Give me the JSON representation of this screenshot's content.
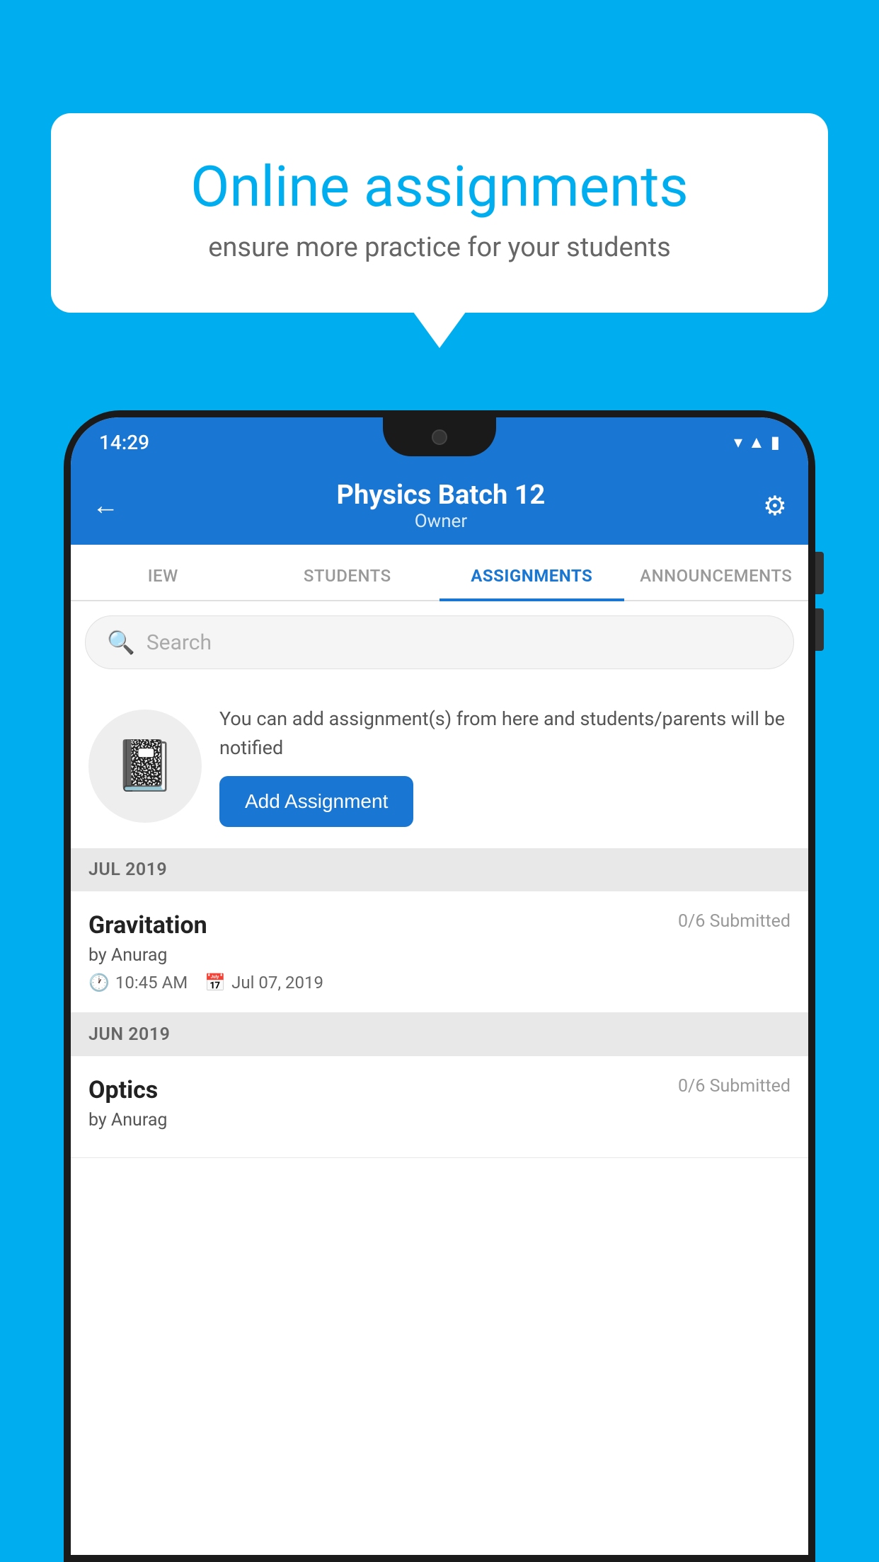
{
  "background_color": "#00AEEF",
  "speech_bubble": {
    "title": "Online assignments",
    "subtitle": "ensure more practice for your students"
  },
  "status_bar": {
    "time": "14:29"
  },
  "header": {
    "title": "Physics Batch 12",
    "subtitle": "Owner"
  },
  "tabs": [
    {
      "label": "IEW",
      "active": false
    },
    {
      "label": "STUDENTS",
      "active": false
    },
    {
      "label": "ASSIGNMENTS",
      "active": true
    },
    {
      "label": "ANNOUNCEMENTS",
      "active": false
    }
  ],
  "search": {
    "placeholder": "Search"
  },
  "promo": {
    "description": "You can add assignment(s) from here and students/parents will be notified",
    "button_label": "Add Assignment"
  },
  "sections": [
    {
      "label": "JUL 2019",
      "assignments": [
        {
          "name": "Gravitation",
          "submitted": "0/6 Submitted",
          "by": "by Anurag",
          "time": "10:45 AM",
          "date": "Jul 07, 2019"
        }
      ]
    },
    {
      "label": "JUN 2019",
      "assignments": [
        {
          "name": "Optics",
          "submitted": "0/6 Submitted",
          "by": "by Anurag",
          "time": "",
          "date": ""
        }
      ]
    }
  ]
}
